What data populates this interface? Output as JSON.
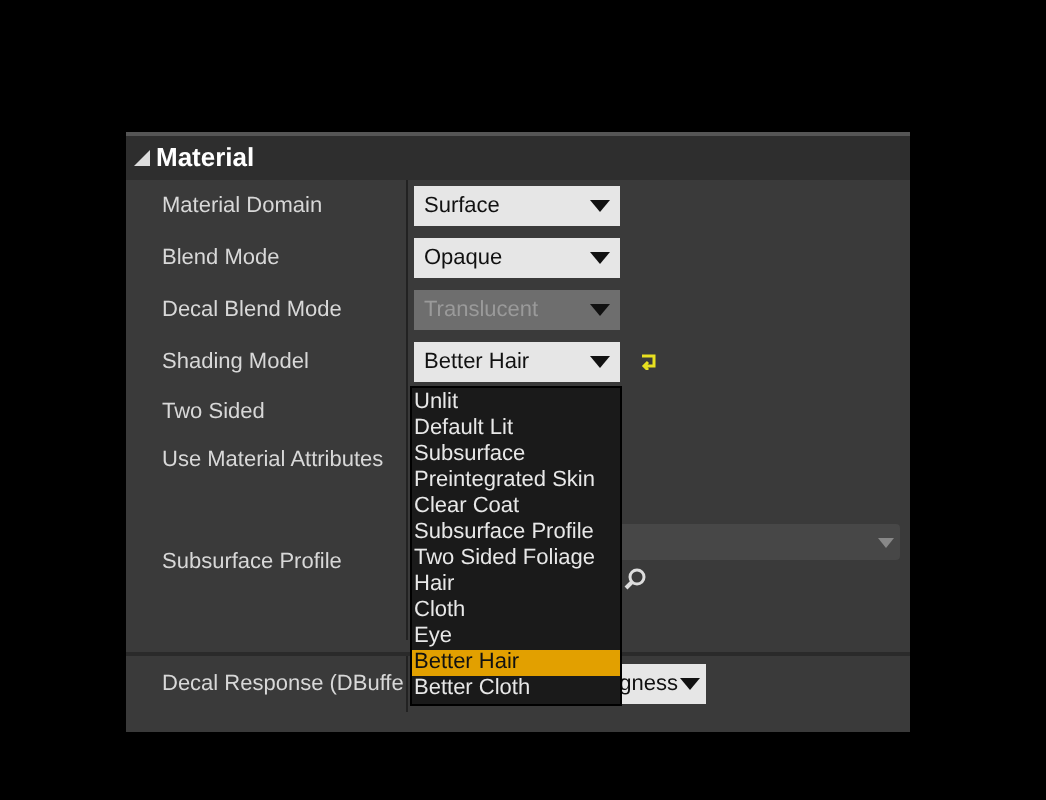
{
  "section": {
    "title": "Material",
    "expanded": true
  },
  "properties": [
    {
      "label": "Material Domain",
      "kind": "dropdown",
      "value": "Surface",
      "disabled": false
    },
    {
      "label": "Blend Mode",
      "kind": "dropdown",
      "value": "Opaque",
      "disabled": false
    },
    {
      "label": "Decal Blend Mode",
      "kind": "dropdown",
      "value": "Translucent",
      "disabled": true
    },
    {
      "label": "Shading Model",
      "kind": "dropdown",
      "value": "Better Hair",
      "disabled": false,
      "modified": true
    },
    {
      "label": "Two Sided",
      "kind": "blank"
    },
    {
      "label": "Use Material Attributes",
      "kind": "blank"
    },
    {
      "label": "Subsurface Profile",
      "kind": "asset"
    },
    {
      "label": "Decal Response (DBuffe",
      "kind": "partial",
      "value": "gness",
      "disabled": false
    }
  ],
  "popup": {
    "items": [
      {
        "label": "Unlit",
        "selected": false
      },
      {
        "label": "Default Lit",
        "selected": false
      },
      {
        "label": "Subsurface",
        "selected": false
      },
      {
        "label": "Preintegrated Skin",
        "selected": false
      },
      {
        "label": "Clear Coat",
        "selected": false
      },
      {
        "label": "Subsurface Profile",
        "selected": false
      },
      {
        "label": "Two Sided Foliage",
        "selected": false
      },
      {
        "label": "Hair",
        "selected": false
      },
      {
        "label": "Cloth",
        "selected": false
      },
      {
        "label": "Eye",
        "selected": false
      },
      {
        "label": "Better Hair",
        "selected": true
      },
      {
        "label": "Better Cloth",
        "selected": false
      }
    ]
  }
}
